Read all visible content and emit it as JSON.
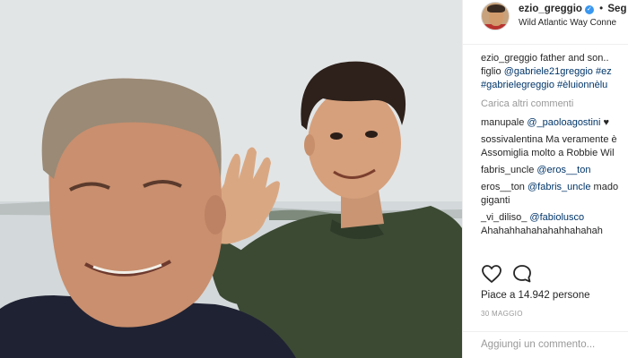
{
  "post": {
    "author": "ezio_greggio",
    "follow_separator": "•",
    "follow_label": "Seg",
    "location": "Wild Atlantic Way Conne",
    "caption_user": "ezio_greggio",
    "caption_line1": "father and son..",
    "caption_line2_prefix": "figlio ",
    "caption_line2_tag1": "@gabriele21greggio",
    "caption_line2_tag2": " #ez",
    "caption_line3_tag1": "#gabrielegreggio",
    "caption_line3_tag2": " #èluionnèlu",
    "load_more": "Carica altri commenti",
    "likes_text": "Piace a 14.942 persone",
    "date": "30 MAGGIO",
    "add_comment_placeholder": "Aggiungi un commento..."
  },
  "comments": [
    {
      "user": "manupale",
      "parts": [
        {
          "t": "tag",
          "v": " @_paoloagostini"
        },
        {
          "t": "text",
          "v": " ♥"
        }
      ],
      "line2": ""
    },
    {
      "user": "sossivalentina",
      "parts": [
        {
          "t": "text",
          "v": " Ma veramente è"
        }
      ],
      "line2": "Assomiglia molto a Robbie Wil"
    },
    {
      "user": "fabris_uncle",
      "parts": [
        {
          "t": "tag",
          "v": " @eros__ton"
        }
      ],
      "line2": ""
    },
    {
      "user": "eros__ton",
      "parts": [
        {
          "t": "tag",
          "v": " @fabris_uncle"
        },
        {
          "t": "text",
          "v": " mado"
        }
      ],
      "line2": "giganti"
    },
    {
      "user": "_vi_diliso_",
      "parts": [
        {
          "t": "tag",
          "v": " @fabiolusco"
        }
      ],
      "line2": "Ahahahhahahahahhahahah"
    }
  ],
  "icons": {
    "heart": "heart-icon",
    "comment": "comment-bubble-icon",
    "verified": "verified-badge-icon"
  },
  "colors": {
    "link": "#003569",
    "muted": "#999999",
    "verified": "#3897f0",
    "text": "#262626"
  }
}
